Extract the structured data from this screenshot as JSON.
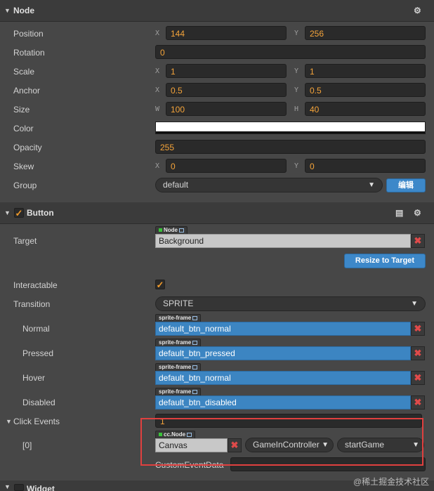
{
  "node": {
    "header": "Node",
    "position": {
      "label": "Position",
      "x_axis": "X",
      "x": "144",
      "y_axis": "Y",
      "y": "256"
    },
    "rotation": {
      "label": "Rotation",
      "value": "0"
    },
    "scale": {
      "label": "Scale",
      "x_axis": "X",
      "x": "1",
      "y_axis": "Y",
      "y": "1"
    },
    "anchor": {
      "label": "Anchor",
      "x_axis": "X",
      "x": "0.5",
      "y_axis": "Y",
      "y": "0.5"
    },
    "size": {
      "label": "Size",
      "w_axis": "W",
      "w": "100",
      "h_axis": "H",
      "h": "40"
    },
    "color": {
      "label": "Color",
      "value": "#ffffff"
    },
    "opacity": {
      "label": "Opacity",
      "value": "255"
    },
    "skew": {
      "label": "Skew",
      "x_axis": "X",
      "x": "0",
      "y_axis": "Y",
      "y": "0"
    },
    "group": {
      "label": "Group",
      "value": "default",
      "edit_label": "编辑"
    }
  },
  "button": {
    "header": "Button",
    "target": {
      "label": "Target",
      "tag": "Node",
      "value": "Background"
    },
    "resize_label": "Resize to Target",
    "interactable": {
      "label": "Interactable"
    },
    "transition": {
      "label": "Transition",
      "value": "SPRITE"
    },
    "normal": {
      "label": "Normal",
      "tag": "sprite-frame",
      "value": "default_btn_normal"
    },
    "pressed": {
      "label": "Pressed",
      "tag": "sprite-frame",
      "value": "default_btn_pressed"
    },
    "hover": {
      "label": "Hover",
      "tag": "sprite-frame",
      "value": "default_btn_normal"
    },
    "disabled": {
      "label": "Disabled",
      "tag": "sprite-frame",
      "value": "default_btn_disabled"
    },
    "click_events": {
      "label": "Click Events",
      "count": "1"
    },
    "event0": {
      "label": "[0]",
      "tag": "cc.Node",
      "node": "Canvas",
      "component": "GameInController",
      "handler": "startGame",
      "custom_label": "CustomEventData"
    }
  },
  "next_section": {
    "header": "Widget"
  },
  "watermark": "@稀土掘金技术社区",
  "colors": {
    "accent_orange": "#f5a43a",
    "blue": "#3d88c9",
    "highlight_red": "#e0403f"
  }
}
